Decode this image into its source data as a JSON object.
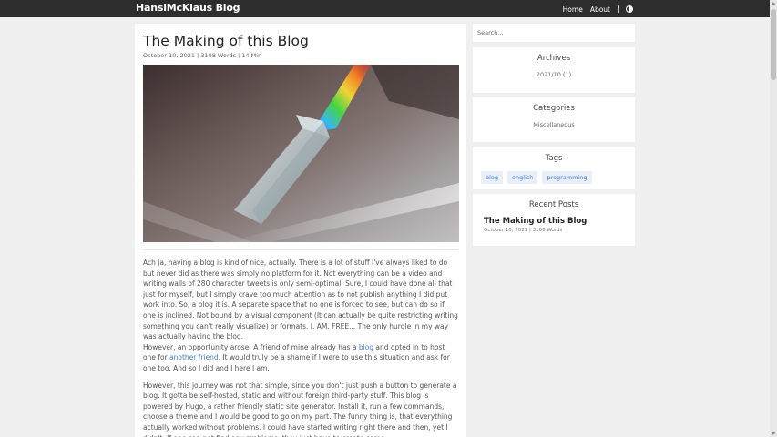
{
  "nav": {
    "brand": "HansiMcKlaus Blog",
    "home_label": "Home",
    "about_label": "About",
    "theme_icon": "moon-icon"
  },
  "post": {
    "title": "The Making of this Blog",
    "date": "October 10, 2021",
    "words": "3108 Words",
    "read_time": "14 Min",
    "hero_alt": "prism refracting light into a rainbow",
    "p1": "Ach ja, having a blog is kind of nice, actually. There is a lot of stuff I've always liked to do but never did as there was simply no platform for it. Not everything can be a video and writing walls of 280 character tweets is only semi-optimal. Sure, I could have done all that just for myself, but I simply crave too much attention as to not publish anything I did put work into. So, a blog it is. A separate space that no one is forced to see, but can do so if one is inclined. Not bound by a visual component (It can actually be quite restricting writing something you can't really visualize) or formats. I. AM. FREE... The only hurdle in my way was actually having the blog.",
    "p2_a": "However, an opportunity arose: A friend of mine already has a ",
    "p2_link1": "blog",
    "p2_b": " and opted in to host one for ",
    "p2_link2": "another friend",
    "p2_c": ". It would truly be a shame if I were to use this situation and ask for one too. And so I did and I here I am.",
    "p3": "However, this journey was not that simple, since you don't just push a button to generate a blog. It gotta be self-hosted, static and without foreign third-party stuff. This blog is powered by Hugo, a rather friendly static site generator. Install it, run a few commands, choose a theme and I would be good to go on my part. The funny thing is, that everything actually worked without problems. I could have started writing right there and then, yet I didn't. If one can not find any problems, they just have to create some."
  },
  "sidebar": {
    "search_placeholder": "Search...",
    "archives_title": "Archives",
    "archives_item": "2021/10 (1)",
    "categories_title": "Categories",
    "categories_item": "Miscellaneous",
    "tags_title": "Tags",
    "tags": [
      "blog",
      "english",
      "programming"
    ],
    "recent_title": "Recent Posts",
    "recent_post_title": "The Making of this Blog",
    "recent_post_meta": "October 10, 2021 | 3108 Words"
  }
}
